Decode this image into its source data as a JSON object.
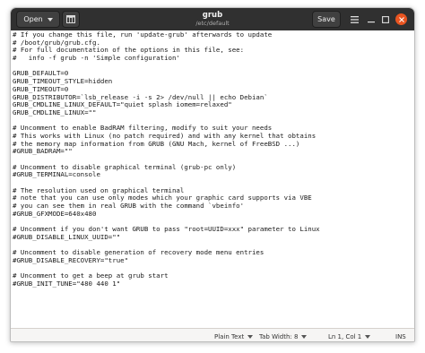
{
  "header": {
    "open_label": "Open",
    "title": "grub",
    "subtitle": "/etc/default",
    "save_label": "Save"
  },
  "editor": {
    "lines": [
      "# If you change this file, run 'update-grub' afterwards to update",
      "# /boot/grub/grub.cfg.",
      "# For full documentation of the options in this file, see:",
      "#   info -f grub -n 'Simple configuration'",
      "",
      "GRUB_DEFAULT=0",
      "GRUB_TIMEOUT_STYLE=hidden",
      "GRUB_TIMEOUT=0",
      "GRUB_DISTRIBUTOR=`lsb_release -i -s 2> /dev/null || echo Debian`",
      "GRUB_CMDLINE_LINUX_DEFAULT=\"quiet splash iomem=relaxed\"",
      "GRUB_CMDLINE_LINUX=\"\"",
      "",
      "# Uncomment to enable BadRAM filtering, modify to suit your needs",
      "# This works with Linux (no patch required) and with any kernel that obtains",
      "# the memory map information from GRUB (GNU Mach, kernel of FreeBSD ...)",
      "#GRUB_BADRAM=\"\"",
      "",
      "# Uncomment to disable graphical terminal (grub-pc only)",
      "#GRUB_TERMINAL=console",
      "",
      "# The resolution used on graphical terminal",
      "# note that you can use only modes which your graphic card supports via VBE",
      "# you can see them in real GRUB with the command `vbeinfo'",
      "#GRUB_GFXMODE=640x480",
      "",
      "# Uncomment if you don't want GRUB to pass \"root=UUID=xxx\" parameter to Linux",
      "#GRUB_DISABLE_LINUX_UUID=\"\"",
      "",
      "# Uncomment to disable generation of recovery mode menu entries",
      "#GRUB_DISABLE_RECOVERY=\"true\"",
      "",
      "# Uncomment to get a beep at grub start",
      "#GRUB_INIT_TUNE=\"480 440 1\""
    ]
  },
  "statusbar": {
    "language": "Plain Text",
    "tab_width": "Tab Width: 8",
    "position": "Ln 1, Col 1",
    "mode": "INS"
  },
  "icons": {
    "open_dropdown": "chevron-down-icon",
    "new_tab": "new-tab-icon",
    "menu": "hamburger-menu-icon",
    "minimize": "minimize-icon",
    "maximize": "maximize-icon",
    "close": "close-icon"
  },
  "colors": {
    "headerbar": "#303030",
    "close_button": "#e95420",
    "editor_bg": "#ffffff",
    "statusbar_bg": "#f6f5f4"
  }
}
